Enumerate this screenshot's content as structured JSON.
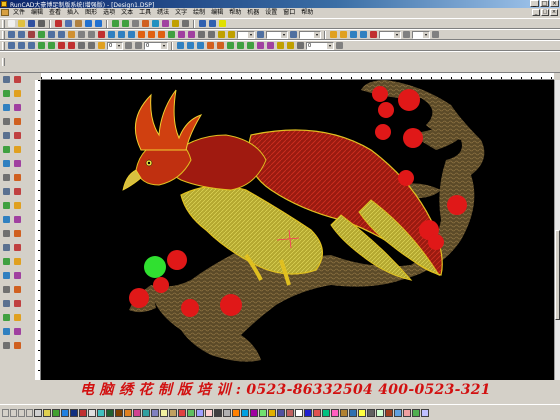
{
  "window": {
    "title": "RunCAD大豪博足制版系统(增强版) - [Design1.DSP]",
    "buttons": [
      "_",
      "□",
      "×"
    ]
  },
  "menu": {
    "items": [
      "文件",
      "编辑",
      "查看",
      "插入",
      "图形",
      "选项",
      "文本",
      "工具",
      "绣法",
      "文字",
      "绘制",
      "编辑",
      "帮助",
      "机器",
      "设置",
      "窗口",
      "帮助"
    ]
  },
  "toolbar2": {
    "fields": [
      "",
      "",
      "",
      "",
      ""
    ]
  },
  "toolbar3": {
    "fields": [
      "0",
      "0",
      "0"
    ]
  },
  "banner": {
    "text": "电 脑 绣 花 制 版 培 训 :  0523-86332504   400-0523-321"
  },
  "palette": {
    "colors": [
      "#d0d0d0",
      "#e0d050",
      "#40a030",
      "#2080e0",
      "#103080",
      "#c03030",
      "#e0e0e0",
      "#40c0c0",
      "#206030",
      "#804000",
      "#e08020",
      "#d04090",
      "#30a0a0",
      "#8080c0",
      "#f0f0a0",
      "#c0a060",
      "#e04040",
      "#60c060",
      "#a0a0ff",
      "#ffd0d0",
      "#404040",
      "#b0b0b0",
      "#ff8000",
      "#00a0e0",
      "#a000a0",
      "#70e070",
      "#e0b000",
      "#5050a0",
      "#c06060",
      "#ffffff",
      "#2020d0",
      "#e05050",
      "#00c080",
      "#ff60c0",
      "#b08030",
      "#3070b0",
      "#ffff40",
      "#606060",
      "#d0ffd0",
      "#a04020",
      "#60a0e0",
      "#f0a0a0",
      "#50b050",
      "#c0c0ff"
    ]
  },
  "colors": {
    "canvas_bg": "#000000",
    "branch": "#6b5530",
    "bird_red": "#b02010",
    "bird_yellow": "#e0c020",
    "blossom_red": "#e01818",
    "blossom_green": "#30e030",
    "banner": "#d21010"
  }
}
